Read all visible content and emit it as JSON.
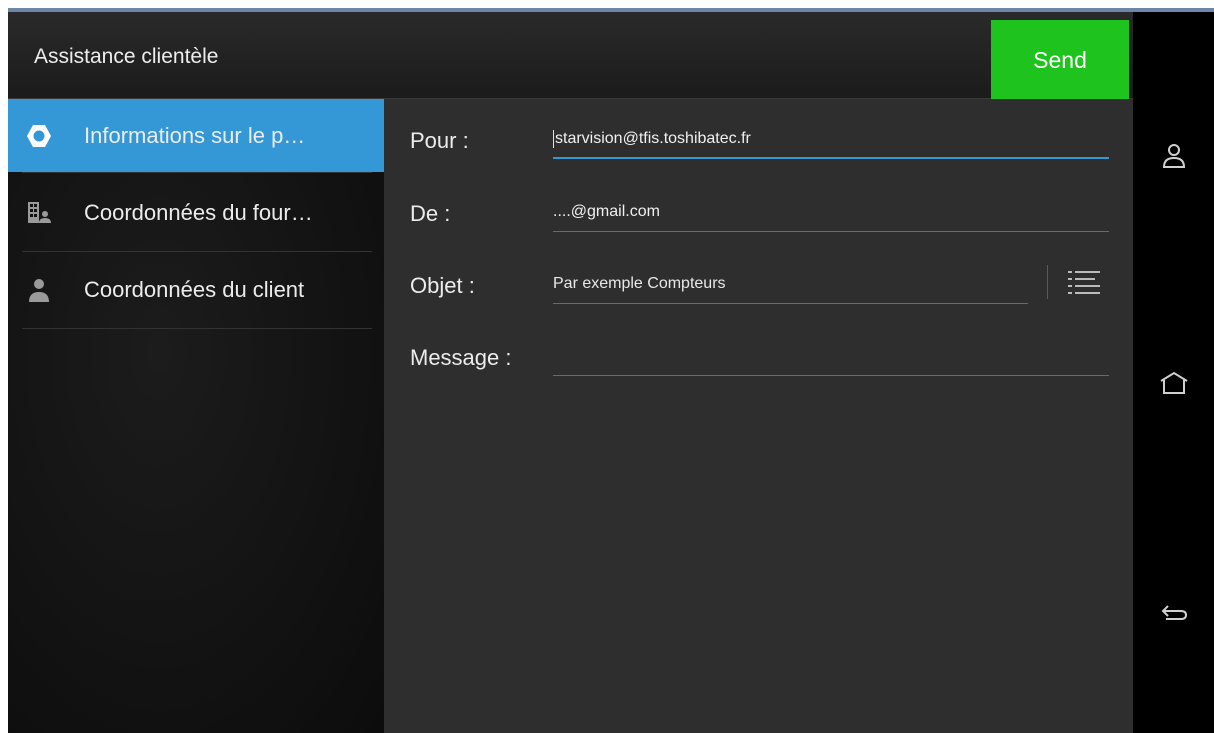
{
  "header": {
    "title": "Assistance clientèle",
    "send_label": "Send"
  },
  "sidebar": {
    "items": [
      {
        "label": "Informations sur le p…",
        "icon": "hexagon-icon",
        "active": true
      },
      {
        "label": "Coordonnées du four…",
        "icon": "building-person-icon",
        "active": false
      },
      {
        "label": "Coordonnées du client",
        "icon": "person-icon",
        "active": false
      }
    ]
  },
  "form": {
    "to_label": "Pour :",
    "to_value": "starvision@tfis.toshibatec.fr",
    "from_label": "De :",
    "from_value": "....@gmail.com",
    "subject_label": "Objet :",
    "subject_placeholder": "Par exemple Compteurs",
    "message_label": "Message :",
    "message_value": ""
  },
  "navbar": {
    "icons": [
      "person-icon",
      "home-icon",
      "back-icon"
    ]
  },
  "colors": {
    "accent": "#3498d6",
    "send": "#1ec31e",
    "underline_active": "#3498d6"
  }
}
